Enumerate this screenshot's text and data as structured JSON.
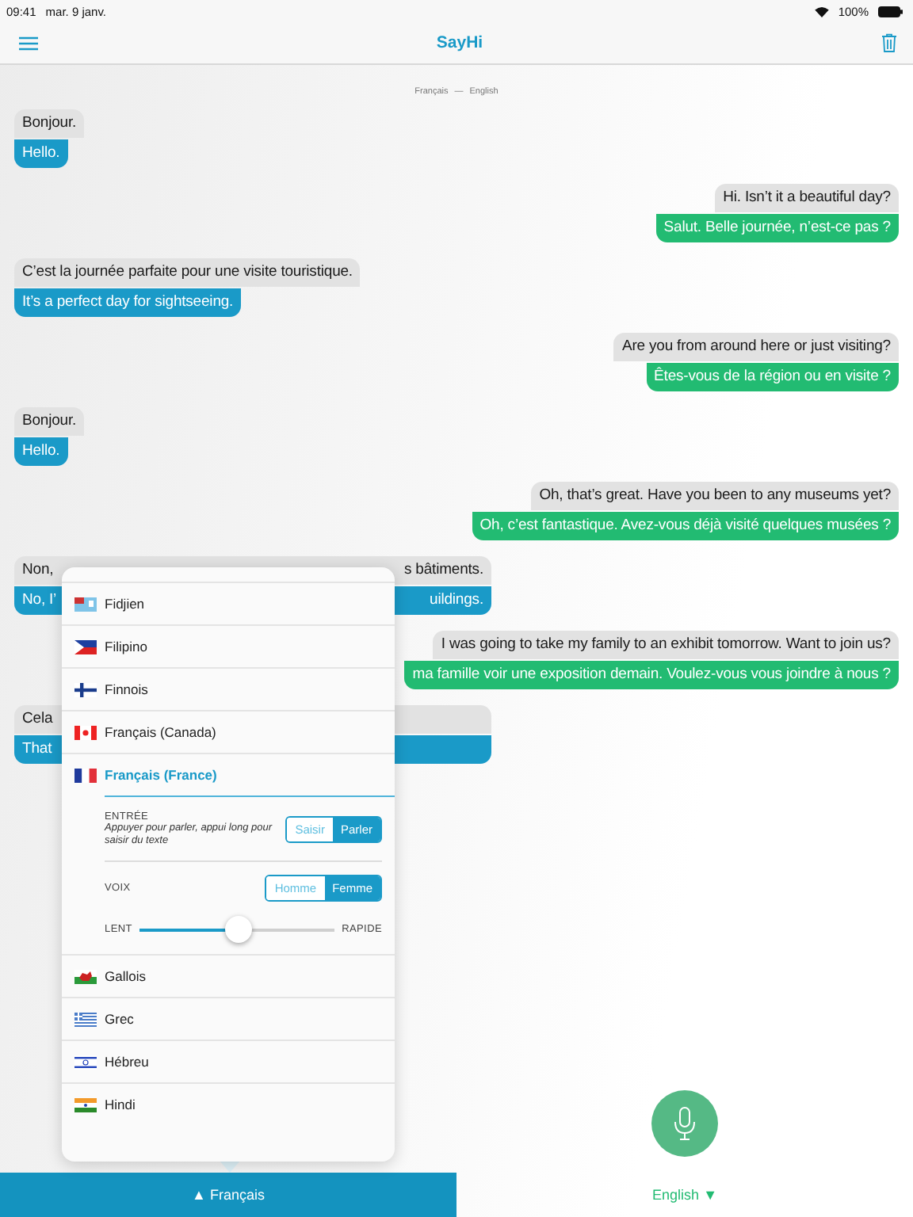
{
  "status_bar": {
    "time": "09:41",
    "date": "mar. 9 janv.",
    "battery": "100%"
  },
  "nav_bar": {
    "title": "SayHi"
  },
  "language_header": {
    "source": "Français",
    "separator": "—",
    "target": "English"
  },
  "messages": [
    {
      "kind": "incoming",
      "covered": false,
      "original": [
        "Bonjour."
      ],
      "translation": [
        "Hello."
      ]
    },
    {
      "kind": "outgoing",
      "covered": false,
      "original": [
        "Hi. Isn’t it a beautiful day?"
      ],
      "translation": [
        "Salut. Belle journée, n’est-ce pas ?"
      ]
    },
    {
      "kind": "incoming",
      "covered": false,
      "original": [
        "C’est la journée parfaite pour une visite touristique."
      ],
      "translation": [
        "It’s a perfect day for sightseeing."
      ]
    },
    {
      "kind": "outgoing",
      "covered": false,
      "original": [
        "Are you from around here or just visiting?"
      ],
      "translation": [
        "Êtes-vous de la région ou en visite ?"
      ]
    },
    {
      "kind": "incoming",
      "covered": false,
      "original": [
        "Bonjour."
      ],
      "translation": [
        "Hello."
      ]
    },
    {
      "kind": "outgoing",
      "covered": false,
      "original": [
        "Oh, that’s great. Have you been to any museums yet?"
      ],
      "translation": [
        "Oh, c’est fantastique. Avez-vous déjà visité quelques musées ?"
      ]
    },
    {
      "kind": "incoming",
      "covered": true,
      "original": [
        "Non,",
        "s bâtiments."
      ],
      "translation": [
        "No, I’",
        "uildings."
      ]
    },
    {
      "kind": "outgoing",
      "covered": false,
      "original": [
        "I was going to take my family to an exhibit tomorrow. Want to join us?"
      ],
      "translation": [
        "ma famille voir une exposition demain. Voulez-vous vous joindre à nous ?"
      ]
    },
    {
      "kind": "incoming",
      "covered": true,
      "original": [
        "Cela"
      ],
      "translation": [
        "That"
      ]
    }
  ],
  "language_picker": {
    "items": [
      {
        "label": "Fidjien",
        "selected": false
      },
      {
        "label": "Filipino",
        "selected": false
      },
      {
        "label": "Finnois",
        "selected": false
      },
      {
        "label": "Français (Canada)",
        "selected": false
      },
      {
        "label": "Français (France)",
        "selected": true,
        "settings": {
          "input_label": "ENTRÉE",
          "input_hint": "Appuyer pour parler, appui long pour saisir du texte",
          "input_modes": [
            {
              "label": "Saisir",
              "selected": false
            },
            {
              "label": "Parler",
              "selected": true
            }
          ],
          "voice_label": "VOIX",
          "voices": [
            {
              "label": "Homme",
              "selected": false
            },
            {
              "label": "Femme",
              "selected": true
            }
          ],
          "speed": {
            "min_label": "LENT",
            "max_label": "RAPIDE",
            "level": 0.5
          }
        }
      },
      {
        "label": "Gallois",
        "selected": false
      },
      {
        "label": "Grec",
        "selected": false
      },
      {
        "label": "Hébreu",
        "selected": false
      },
      {
        "label": "Hindi",
        "selected": false
      }
    ]
  },
  "bottom_bar": {
    "source_button": {
      "arrow": "▲",
      "label": "Français"
    },
    "target_button": {
      "label": "English",
      "arrow": "▼"
    }
  }
}
